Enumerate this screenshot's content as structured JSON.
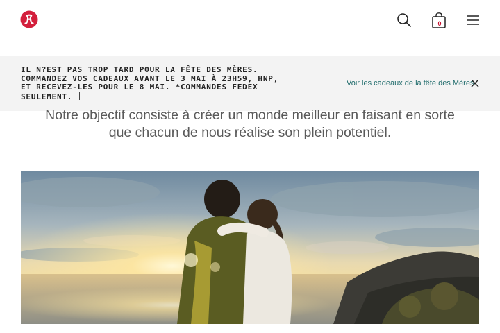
{
  "header": {
    "logo": "lululemon-logo-icon",
    "search_icon": "search-icon",
    "bag_icon": "shopping-bag-icon",
    "bag_count": "0",
    "menu_icon": "hamburger-menu-icon"
  },
  "banner": {
    "lines": [
      "IL N?EST PAS TROP TARD POUR LA FÊTE DES MÈRES.",
      "COMMANDEZ VOS CADEAUX AVANT LE 3 MAI À 23H59, HNP,",
      "ET RECEVEZ-LES POUR LE 8 MAI. *COMMANDES FEDEX",
      "SEULEMENT."
    ],
    "link": "Voir les cadeaux de la fête des Mères",
    "close_icon": "close-icon"
  },
  "mission": {
    "line1": "Notre objectif consiste à créer un monde meilleur en faisant en sorte",
    "line2": "que chacun de nous réalise son plein potentiel."
  },
  "hero": {
    "image": "couple-embracing-at-sunset-over-ocean-coast"
  },
  "colors": {
    "brand_red": "#d31f3c",
    "banner_bg": "#f3f3f3",
    "link_teal": "#1f6b6b"
  }
}
